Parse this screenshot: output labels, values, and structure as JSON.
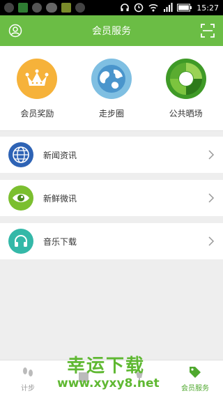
{
  "status_bar": {
    "time": "15:27",
    "icons": [
      "clock-icon",
      "wifi-icon",
      "signal-icon",
      "battery-icon",
      "headphones-icon"
    ]
  },
  "app_bar": {
    "title": "会员服务",
    "left_icon": "user-icon",
    "right_icon": "scan-icon",
    "color": "#6bbd45"
  },
  "features": [
    {
      "label": "会员奖励",
      "icon": "crown-icon",
      "color": "#f6b23a"
    },
    {
      "label": "走步圈",
      "icon": "globe-icon",
      "color": "#5aa9d6"
    },
    {
      "label": "公共晒场",
      "icon": "recycle-icon",
      "color": "#5db43a"
    }
  ],
  "list": [
    {
      "label": "新闻资讯",
      "icon": "globe-icon",
      "color": "#2e63b5"
    },
    {
      "label": "新鲜微讯",
      "icon": "eye-icon",
      "color": "#7bbf2f"
    },
    {
      "label": "音乐下载",
      "icon": "headphones-icon",
      "color": "#34b8a8"
    }
  ],
  "bottom_nav": [
    {
      "label": "计步",
      "icon": "footprints-icon",
      "active": false
    },
    {
      "label": "",
      "icon": "book-icon",
      "active": false
    },
    {
      "label": "",
      "icon": "cup-icon",
      "active": false
    },
    {
      "label": "会员服务",
      "icon": "tag-icon",
      "active": true
    }
  ],
  "watermark": {
    "line1": "幸运下载",
    "line2": "www.xyxy8.net"
  }
}
